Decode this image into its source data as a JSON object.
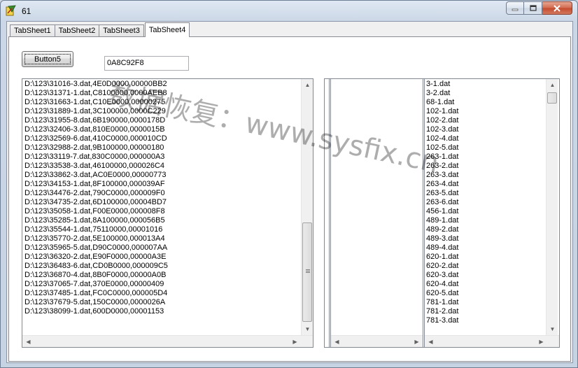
{
  "window": {
    "title": "61"
  },
  "tabs": [
    {
      "label": "TabSheet1"
    },
    {
      "label": "TabSheet2"
    },
    {
      "label": "TabSheet3"
    },
    {
      "label": "TabSheet4"
    }
  ],
  "button5": {
    "label": "Button5"
  },
  "hex_field": {
    "value": "0A8C92F8"
  },
  "left_memo": {
    "lines": [
      "D:\\123\\31016-3.dat,4E0D0000,00000BB2",
      "D:\\123\\31371-1.dat,C8100000,0000AEB8",
      "D:\\123\\31663-1.dat,C10E0000,00000275",
      "D:\\123\\31889-1.dat,3C100000,0000C229",
      "D:\\123\\31955-8.dat,6B190000,0000178D",
      "D:\\123\\32406-3.dat,810E0000,0000015B",
      "D:\\123\\32569-6.dat,410C0000,000010CD",
      "D:\\123\\32988-2.dat,9B100000,00000180",
      "D:\\123\\33119-7.dat,830C0000,000000A3",
      "D:\\123\\33538-3.dat,46100000,000026C4",
      "D:\\123\\33862-3.dat,AC0E0000,00000773",
      "D:\\123\\34153-1.dat,8F100000,000039AF",
      "D:\\123\\34476-2.dat,790C0000,000009F0",
      "D:\\123\\34735-2.dat,6D100000,00004BD7",
      "D:\\123\\35058-1.dat,F00E0000,000008F8",
      "D:\\123\\35285-1.dat,8A100000,000056B5",
      "D:\\123\\35544-1.dat,75110000,00001016",
      "D:\\123\\35770-2.dat,5E100000,000013A4",
      "D:\\123\\35965-5.dat,D90C0000,000007AA",
      "D:\\123\\36320-2.dat,E90F0000,00000A3E",
      "D:\\123\\36483-6.dat,CD0B0000,000009C5",
      "D:\\123\\36870-4.dat,8B0F0000,00000A0B",
      "D:\\123\\37065-7.dat,370E0000,00000409",
      "D:\\123\\37485-1.dat,FC0C0000,000005D4",
      "D:\\123\\37679-5.dat,150C0000,0000026A",
      "D:\\123\\38099-1.dat,600D0000,00001153"
    ]
  },
  "right_list": {
    "items": [
      "3-1.dat",
      "3-2.dat",
      "68-1.dat",
      "102-1.dat",
      "102-2.dat",
      "102-3.dat",
      "102-4.dat",
      "102-5.dat",
      "263-1.dat",
      "263-2.dat",
      "263-3.dat",
      "263-4.dat",
      "263-5.dat",
      "263-6.dat",
      "456-1.dat",
      "489-1.dat",
      "489-2.dat",
      "489-3.dat",
      "489-4.dat",
      "620-1.dat",
      "620-2.dat",
      "620-3.dat",
      "620-4.dat",
      "620-5.dat",
      "781-1.dat",
      "781-2.dat",
      "781-3.dat"
    ]
  },
  "watermark": {
    "text": "数据恢复：www.sysfix.cn"
  },
  "icons": {
    "app": "app-icon",
    "minimize": "minimize-icon",
    "maximize": "maximize-icon",
    "close": "close-icon"
  }
}
